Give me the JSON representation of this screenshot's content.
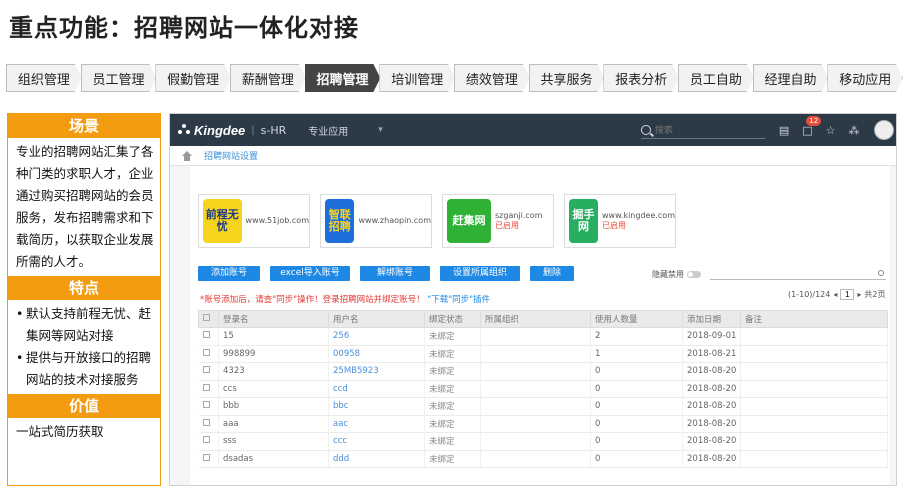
{
  "slide": {
    "title": "重点功能：招聘网站一体化对接"
  },
  "tabs": [
    "组织管理",
    "员工管理",
    "假勤管理",
    "薪酬管理",
    "招聘管理",
    "培训管理",
    "绩效管理",
    "共享服务",
    "报表分析",
    "员工自助",
    "经理自助",
    "移动应用"
  ],
  "active_tab_index": 4,
  "left": {
    "scene_title": "场景",
    "scene_text": "专业的招聘网站汇集了各种门类的求职人才，企业通过购买招聘网站的会员服务，发布招聘需求和下载简历，以获取企业发展所需的人才。",
    "feature_title": "特点",
    "features": [
      "默认支持前程无忧、赶集网等网站对接",
      "提供与开放接口的招聘网站的技术对接服务"
    ],
    "value_title": "价值",
    "value_text": "一站式简历获取"
  },
  "app": {
    "logo": "Kingdee",
    "product": "s-HR",
    "menu": "专业应用",
    "search_placeholder": "搜索",
    "notification_count": "12",
    "breadcrumb": "招聘网站设置",
    "sites": [
      {
        "logo": "前程无忧",
        "domain": "www.51job.com",
        "status": "",
        "color": "#f6d31c",
        "text_color": "#1a3a8a"
      },
      {
        "logo": "智联招聘",
        "domain": "www.zhaopin.com",
        "status": "",
        "color": "#1e6fd9",
        "text_color": "#ffd21f"
      },
      {
        "logo": "赶集网",
        "domain": "szganji.com",
        "status": "已启用",
        "color": "#2eb135",
        "text_color": "#ffffff"
      },
      {
        "logo": "掘手网",
        "domain": "www.kingdee.com",
        "status": "已启用",
        "color": "#27ae60",
        "text_color": "#ffffff"
      }
    ],
    "buttons": [
      "添加账号",
      "excel导入账号",
      "解绑账号",
      "设置所属组织",
      "删除"
    ],
    "toggle_label": "隐藏禁用",
    "warning": "*账号添加后，请查\"同步\"操作！登录招聘网站并绑定账号！",
    "warning_link": "\"下载\"同步\"插件",
    "pager": {
      "range": "(1-10)/124",
      "page": "1",
      "total": "共2页"
    },
    "columns": [
      "登录名",
      "用户名",
      "绑定状态",
      "所属组织",
      "使用人数量",
      "添加日期",
      "备注"
    ],
    "rows": [
      {
        "login": "15",
        "user": "256",
        "status": "未绑定",
        "org": "",
        "count": "2",
        "date": "2018-09-01"
      },
      {
        "login": "998899",
        "user": "00958",
        "status": "未绑定",
        "org": "",
        "count": "1",
        "date": "2018-08-21"
      },
      {
        "login": "4323",
        "user": "25MB5923",
        "status": "未绑定",
        "org": "",
        "count": "0",
        "date": "2018-08-20"
      },
      {
        "login": "ccs",
        "user": "ccd",
        "status": "未绑定",
        "org": "",
        "count": "0",
        "date": "2018-08-20"
      },
      {
        "login": "bbb",
        "user": "bbc",
        "status": "未绑定",
        "org": "",
        "count": "0",
        "date": "2018-08-20"
      },
      {
        "login": "aaa",
        "user": "aac",
        "status": "未绑定",
        "org": "",
        "count": "0",
        "date": "2018-08-20"
      },
      {
        "login": "sss",
        "user": "ccc",
        "status": "未绑定",
        "org": "",
        "count": "0",
        "date": "2018-08-20"
      },
      {
        "login": "dsadas",
        "user": "ddd",
        "status": "未绑定",
        "org": "",
        "count": "0",
        "date": "2018-08-20"
      }
    ]
  }
}
